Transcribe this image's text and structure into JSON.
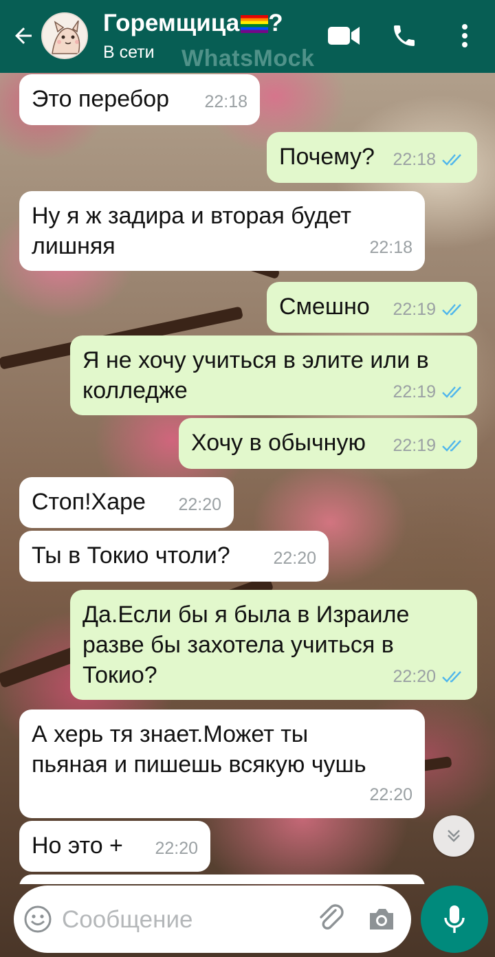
{
  "header": {
    "contact_name": "Горемщица",
    "name_suffix": "?",
    "status": "В сети",
    "watermark": "WhatsMock"
  },
  "messages": [
    {
      "direction": "in",
      "text": "Это перебор",
      "time": "22:18"
    },
    {
      "direction": "out",
      "text": "Почему?",
      "time": "22:18",
      "read": true
    },
    {
      "direction": "in",
      "text": "Ну я ж задира и вторая будет\nлишняя",
      "time": "22:18"
    },
    {
      "direction": "out",
      "text": "Смешно",
      "time": "22:19",
      "read": true
    },
    {
      "direction": "out",
      "text": "Я не хочу учиться в элите или в\nколледже",
      "time": "22:19",
      "read": true
    },
    {
      "direction": "out",
      "text": "Хочу в обычную",
      "time": "22:19",
      "read": true
    },
    {
      "direction": "in",
      "text": "Стоп!Харе",
      "time": "22:20"
    },
    {
      "direction": "in",
      "text": "Ты в Токио чтоли?",
      "time": "22:20"
    },
    {
      "direction": "out",
      "text": "Да.Если бы я была в Израиле\nразве бы захотела  учиться в\nТокио?",
      "time": "22:20",
      "read": true
    },
    {
      "direction": "in",
      "text": "А херь тя знает.Может ты\nпьяная и пишешь всякую чушь",
      "time": "22:20"
    },
    {
      "direction": "in",
      "text": "Но это +",
      "time": "22:20"
    }
  ],
  "composer": {
    "placeholder": "Сообщение"
  },
  "colors": {
    "header": "#075e54",
    "outgoing_bubble": "#e2f8cc",
    "incoming_bubble": "#ffffff",
    "read_ticks": "#4fb6ec",
    "mic_button": "#008a7c"
  }
}
